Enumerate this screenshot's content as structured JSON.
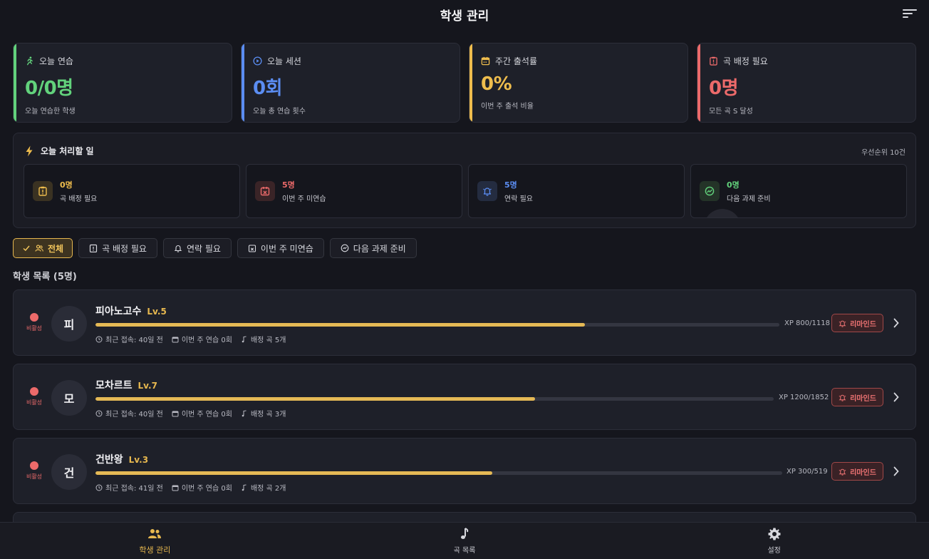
{
  "header": {
    "title": "학생 관리"
  },
  "stats": [
    {
      "label": "오늘 연습",
      "value": "0/0명",
      "sub": "오늘 연습한 학생",
      "color": "#62d27c"
    },
    {
      "label": "오늘 세션",
      "value": "0회",
      "sub": "오늘 총 연습 횟수",
      "color": "#5b8df2"
    },
    {
      "label": "주간 출석률",
      "value": "0%",
      "sub": "이번 주 출석 비율",
      "color": "#efbd4d"
    },
    {
      "label": "곡 배정 필요",
      "value": "0명",
      "sub": "모든 곡 S 달성",
      "color": "#ec6a6a"
    }
  ],
  "today": {
    "title": "오늘 처리할 일",
    "priority": "우선순위 10건",
    "tasks": [
      {
        "count": "0명",
        "label": "곡 배정 필요",
        "color": "#efbd4d",
        "bg": "#3a3222"
      },
      {
        "count": "5명",
        "label": "이번 주 미연습",
        "color": "#ec6a6a",
        "bg": "#3a2427"
      },
      {
        "count": "5명",
        "label": "연락 필요",
        "color": "#5b8df2",
        "bg": "#242c40"
      },
      {
        "count": "0명",
        "label": "다음 과제 준비",
        "color": "#62d27c",
        "bg": "#243328"
      }
    ]
  },
  "filters": [
    {
      "label": "전체"
    },
    {
      "label": "곡 배정 필요"
    },
    {
      "label": "연락 필요"
    },
    {
      "label": "이번 주 미연습"
    },
    {
      "label": "다음 과제 준비"
    }
  ],
  "list_title": "학생 목록 (5명)",
  "students": [
    {
      "initial": "피",
      "name": "피아노고수",
      "level": "Lv.5",
      "status": "비활성",
      "xp_text": "XP 800/1118",
      "xp_ratio": 0.7156,
      "last_login": "최근 접속: 40일 전",
      "weekly": "이번 주 연습 0회",
      "songs": "배정 곡 5개",
      "remind": "리마인드"
    },
    {
      "initial": "모",
      "name": "모차르트",
      "level": "Lv.7",
      "status": "비활성",
      "xp_text": "XP 1200/1852",
      "xp_ratio": 0.6479,
      "last_login": "최근 접속: 40일 전",
      "weekly": "이번 주 연습 0회",
      "songs": "배정 곡 3개",
      "remind": "리마인드"
    },
    {
      "initial": "건",
      "name": "건반왕",
      "level": "Lv.3",
      "status": "비활성",
      "xp_text": "XP 300/519",
      "xp_ratio": 0.578,
      "last_login": "최근 접속: 41일 전",
      "weekly": "이번 주 연습 0회",
      "songs": "배정 곡 2개",
      "remind": "리마인드"
    }
  ],
  "nav": [
    {
      "label": "학생 관리",
      "active": true
    },
    {
      "label": "곡 목록",
      "active": false
    },
    {
      "label": "설정",
      "active": false
    }
  ],
  "colors": {
    "accent": "#e7b84f",
    "danger": "#ec6a6a",
    "success": "#62d27c",
    "info": "#5b8df2"
  },
  "icons": [
    "menu-icon",
    "run-icon",
    "play-circle-icon",
    "calendar-icon",
    "clipboard-alert-icon",
    "bolt-icon",
    "calendar-x-icon",
    "bell-icon",
    "gauge-icon",
    "check-icon",
    "users-icon",
    "clock-icon",
    "music-note-icon",
    "chevron-right-icon",
    "gear-icon"
  ]
}
